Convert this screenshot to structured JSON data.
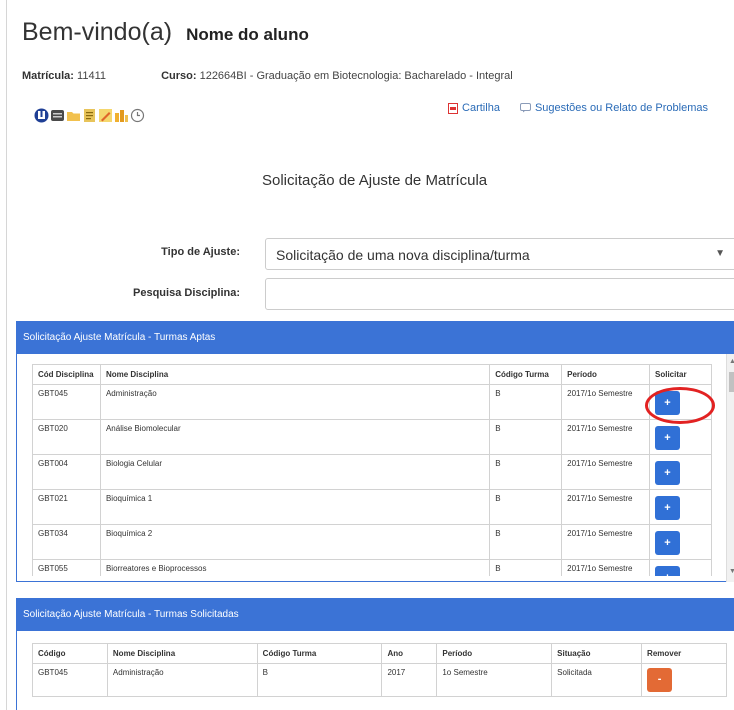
{
  "header": {
    "welcome": "Bem-vindo(a)",
    "student_name": "Nome do aluno"
  },
  "info": {
    "matricula_label": "Matrícula:",
    "matricula_value": "11411",
    "curso_label": "Curso:",
    "curso_value": "122664BI  - Graduação em Biotecnologia: Bacharelado - Integral"
  },
  "links": {
    "cartilha": "Cartilha",
    "sugestoes": "Sugestões ou Relato de Problemas"
  },
  "page_heading": "Solicitação de Ajuste de Matrícula",
  "form": {
    "tipo_label": "Tipo de Ajuste:",
    "tipo_value": "Solicitação de uma nova disciplina/turma",
    "pesquisa_label": "Pesquisa Disciplina:",
    "pesquisa_value": ""
  },
  "aptas": {
    "title": "Solicitação Ajuste Matrícula - Turmas Aptas",
    "columns": [
      "Cód Disciplina",
      "Nome Disciplina",
      "Código Turma",
      "Período",
      "Solicitar"
    ],
    "button_label": "+",
    "rows": [
      {
        "cod": "GBT045",
        "nome": "Administração",
        "turma": "B",
        "periodo": "2017/1o Semestre"
      },
      {
        "cod": "GBT020",
        "nome": "Análise Biomolecular",
        "turma": "B",
        "periodo": "2017/1o Semestre"
      },
      {
        "cod": "GBT004",
        "nome": "Biologia Celular",
        "turma": "B",
        "periodo": "2017/1o Semestre"
      },
      {
        "cod": "GBT021",
        "nome": "Bioquímica 1",
        "turma": "B",
        "periodo": "2017/1o Semestre"
      },
      {
        "cod": "GBT034",
        "nome": "Bioquímica 2",
        "turma": "B",
        "periodo": "2017/1o Semestre"
      },
      {
        "cod": "GBT055",
        "nome": "Biorreatores e Bioprocessos",
        "turma": "B",
        "periodo": "2017/1o Semestre"
      }
    ]
  },
  "solicitadas": {
    "title": "Solicitação Ajuste Matrícula - Turmas Solicitadas",
    "columns": [
      "Código",
      "Nome Disciplina",
      "Código Turma",
      "Ano",
      "Período",
      "Situação",
      "Remover"
    ],
    "button_label": "-",
    "rows": [
      {
        "cod": "GBT045",
        "nome": "Administração",
        "turma": "B",
        "ano": "2017",
        "periodo": "1o Semestre",
        "situacao": "Solicitada"
      }
    ]
  },
  "colors": {
    "panel_blue": "#3b73d6",
    "add_button": "#3070d6",
    "remove_button": "#e36a35",
    "highlight": "#e22222",
    "link": "#2a6bb7"
  },
  "icons": [
    "unb-logo-icon",
    "mail-icon",
    "folder-icon",
    "document-icon",
    "pencil-icon",
    "chart-icon",
    "clock-icon",
    "pdf-icon",
    "comment-icon"
  ]
}
